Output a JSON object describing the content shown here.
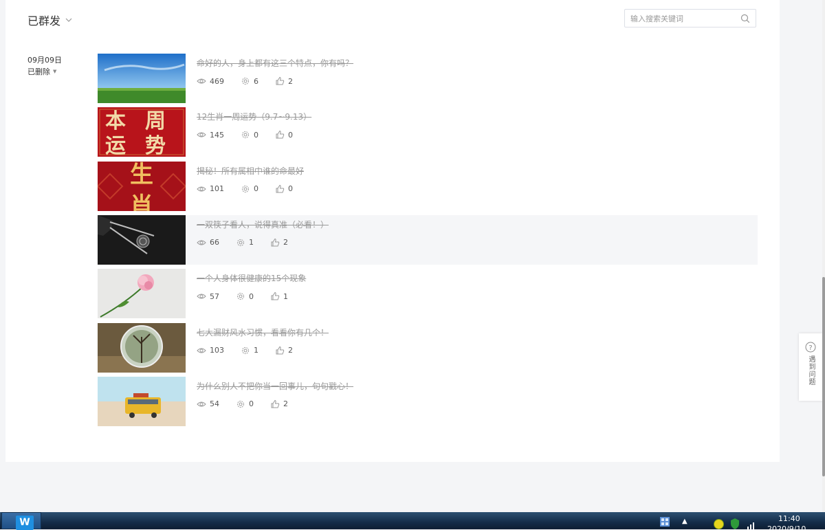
{
  "header": {
    "title": "已群发"
  },
  "search": {
    "placeholder": "输入搜索关键词",
    "value": ""
  },
  "group": {
    "date": "09月09日",
    "status": "已删除"
  },
  "articles": [
    {
      "title": "命好的人，身上都有这三个特点，你有吗？",
      "views": "469",
      "shares": "6",
      "likes": "2"
    },
    {
      "title": "12生肖一周运势（9.7~9.13）",
      "views": "145",
      "shares": "0",
      "likes": "0"
    },
    {
      "title": "揭秘！所有属相中谁的命最好",
      "views": "101",
      "shares": "0",
      "likes": "0"
    },
    {
      "title": "一双筷子看人，说得真准（必看！）",
      "views": "66",
      "shares": "1",
      "likes": "2"
    },
    {
      "title": "一个人身体很健康的15个现象",
      "views": "57",
      "shares": "0",
      "likes": "1"
    },
    {
      "title": "七大漏财风水习惯，看看你有几个！",
      "views": "103",
      "shares": "1",
      "likes": "2"
    },
    {
      "title": "为什么别人不把你当一回事儿，句句戳心！",
      "views": "54",
      "shares": "0",
      "likes": "2"
    }
  ],
  "thumbnails": {
    "t1": "sky-grass-field",
    "t2": {
      "c1": "本",
      "c2": "周",
      "c3": "运",
      "c4": "势"
    },
    "t3": {
      "c1": "生",
      "c2": "肖"
    },
    "t4": "chopsticks",
    "t5": "pink-rose",
    "t6": "crystal-ball",
    "t7": "toy-bus"
  },
  "help": {
    "label": "遇到问题"
  },
  "taskbar": {
    "start_logo": "W",
    "time": "11:40",
    "date": "2020/9/10"
  },
  "colors": {
    "accent": "#1f8fe0",
    "text_muted": "#999999",
    "row_hover": "#f5f6f8"
  }
}
